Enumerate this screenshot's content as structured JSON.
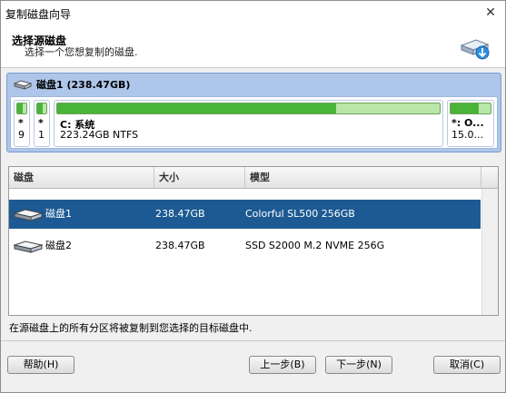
{
  "window": {
    "title": "复制磁盘向导",
    "close_glyph": "✕"
  },
  "header": {
    "title": "选择源磁盘",
    "subtitle": "选择一个您想复制的磁盘.",
    "icon": "disk-copy-icon"
  },
  "disk_map": {
    "label": "磁盘1 (238.47GB)",
    "partitions": [
      {
        "line1": "*",
        "line2": "9",
        "fill": 0.6
      },
      {
        "line1": "*",
        "line2": "1",
        "fill": 0.6
      },
      {
        "line1": "C: 系统",
        "line2": "223.24GB NTFS",
        "fill": 0.73
      },
      {
        "line1": "*: O...",
        "line2": "15.0...",
        "fill": 0.7
      }
    ]
  },
  "list": {
    "columns": [
      "磁盘",
      "大小",
      "模型"
    ],
    "rows": [
      {
        "disk": "磁盘1",
        "size": "238.47GB",
        "model": "Colorful SL500 256GB",
        "selected": true
      },
      {
        "disk": "磁盘2",
        "size": "238.47GB",
        "model": "SSD S2000 M.2  NVME 256G",
        "selected": false
      }
    ]
  },
  "status_text": "在源磁盘上的所有分区将被复制到您选择的目标磁盘中.",
  "buttons": {
    "help": "帮助(H)",
    "back": "上一步(B)",
    "next": "下一步(N)",
    "cancel": "取消(C)"
  },
  "colors": {
    "selection": "#1d5a93",
    "used": "#4ab43a",
    "free": "#b9e7a8",
    "disk_map_bg": "#aec6e9"
  }
}
